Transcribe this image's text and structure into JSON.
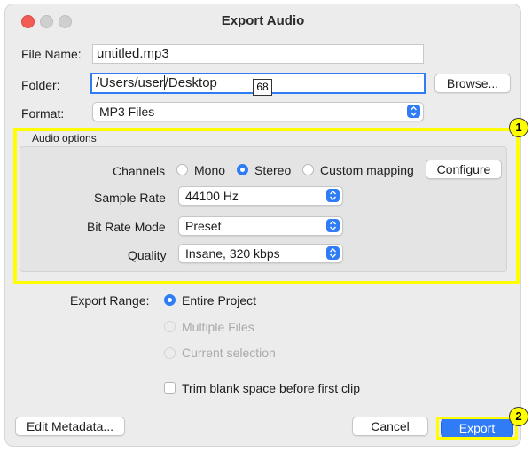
{
  "window": {
    "title": "Export Audio"
  },
  "file_name": {
    "label": "File Name:",
    "value": "untitled.mp3"
  },
  "folder": {
    "label": "Folder:",
    "value_before_cursor": "/Users/user",
    "value_after_cursor": "/Desktop",
    "browse_label": "Browse..."
  },
  "format": {
    "label": "Format:",
    "selected": "MP3 Files"
  },
  "audio_options": {
    "title": "Audio options",
    "channels": {
      "label": "Channels",
      "options": [
        "Mono",
        "Stereo",
        "Custom mapping"
      ],
      "selected": "Stereo",
      "configure_label": "Configure"
    },
    "sample_rate": {
      "label": "Sample Rate",
      "selected": "44100 Hz"
    },
    "bit_rate_mode": {
      "label": "Bit Rate Mode",
      "selected": "Preset"
    },
    "quality": {
      "label": "Quality",
      "selected": "Insane, 320 kbps"
    }
  },
  "export_range": {
    "label": "Export Range:",
    "options": [
      "Entire Project",
      "Multiple Files",
      "Current selection"
    ],
    "selected": "Entire Project"
  },
  "trim": {
    "label": "Trim blank space before first clip",
    "checked": false
  },
  "buttons": {
    "edit_metadata": "Edit Metadata...",
    "cancel": "Cancel",
    "export": "Export"
  },
  "annotations": {
    "tooltip": "68",
    "badge_1": "1",
    "badge_2": "2"
  },
  "colors": {
    "accent": "#2f7cf6",
    "highlight": "#ffff00",
    "close": "#f25c55"
  }
}
